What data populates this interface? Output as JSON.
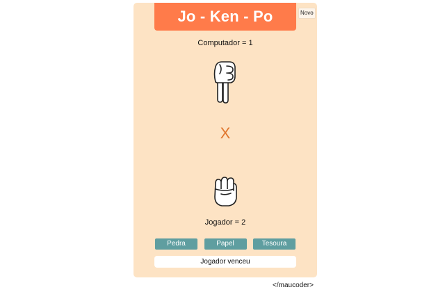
{
  "header": {
    "title": "Jo - Ken - Po",
    "new_button": "Novo"
  },
  "computer": {
    "score_label": "Computador = 1",
    "hand_icon": "scissors-hand-icon"
  },
  "versus": "X",
  "player": {
    "score_label": "Jogador = 2",
    "hand_icon": "fist-rock-hand-icon"
  },
  "choices": [
    "Pedra",
    "Papel",
    "Tesoura"
  ],
  "result": "Jogador venceu",
  "footer": "</maucoder>",
  "colors": {
    "card_bg": "#fde3c4",
    "title_bg": "#ff7b4a",
    "button_bg": "#5f9ea0",
    "versus": "#e0762e"
  }
}
